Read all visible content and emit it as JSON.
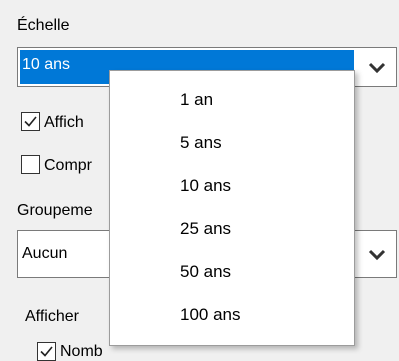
{
  "echelle": {
    "label": "Échelle",
    "selected": "10 ans"
  },
  "checkbox_afficher": {
    "label": "Affich",
    "checked": true
  },
  "checkbox_compr": {
    "label": "Compr",
    "checked": false
  },
  "groupement": {
    "label": "Groupeme",
    "selected": "Aucun"
  },
  "afficher_label": "Afficher",
  "bottom_partial": {
    "label": "Nomb",
    "checked": true
  },
  "dropdown": {
    "options": [
      "1 an",
      "5 ans",
      "10 ans",
      "25 ans",
      "50 ans",
      "100 ans"
    ]
  },
  "colors": {
    "selection": "#0078d7",
    "window_bg": "#f0f0f0",
    "border": "#7a7a7a"
  },
  "icons": {
    "chevron": "chevron-down-icon",
    "check": "checkmark-icon"
  }
}
